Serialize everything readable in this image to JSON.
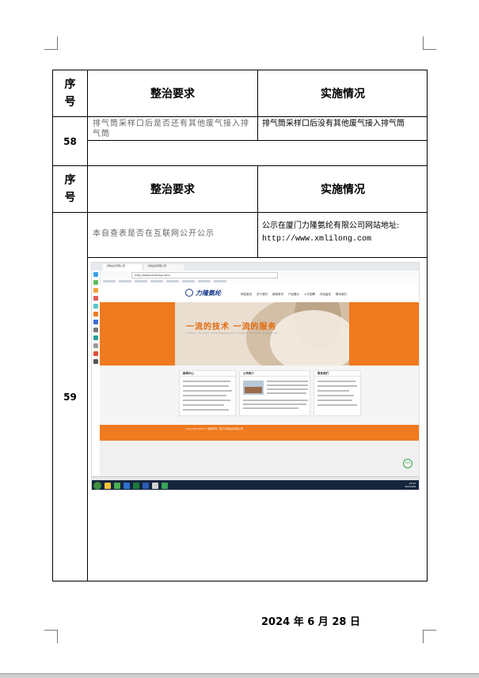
{
  "table": {
    "header_num": "序\n号",
    "header_req": "整治要求",
    "header_impl": "实施情况",
    "rows": [
      {
        "num": "58",
        "requirement": "排气筒采样口后是否还有其他废气接入排气筒",
        "implementation": "排气筒采样口后没有其他废气接入排气筒"
      },
      {
        "num": "59",
        "requirement": "本自查表是否在互联网公开公示",
        "implementation_line1": "公示在厦门力隆氨纶有限公司网站地址:",
        "implementation_line2": "http://www.xmlilong.com"
      }
    ]
  },
  "screenshot": {
    "tab_label": "力隆氨纶有限公司",
    "address": "http://www.xmlilong.com/",
    "logo_text": "力隆氨纶",
    "nav_items": [
      "网站首页",
      "关于我们",
      "新闻资讯",
      "产品展示",
      "人才招聘",
      "在线留言",
      "联系我们"
    ],
    "slogan": "一流的技术  一流的服务",
    "slogan_sub": "FIRST CLASS TECHNOLOGY      FIRST CLASS SERVICE",
    "panels": [
      "新闻中心",
      "公司简介",
      "联系我们"
    ],
    "footer_text": "Copyright 2021 © 版权所有：厦门力隆氨纶有限公司",
    "badge": "72%",
    "clock_time": "14:54",
    "clock_date": "2021/8/6"
  },
  "footer_date": "2024 年 6 月 28 日"
}
